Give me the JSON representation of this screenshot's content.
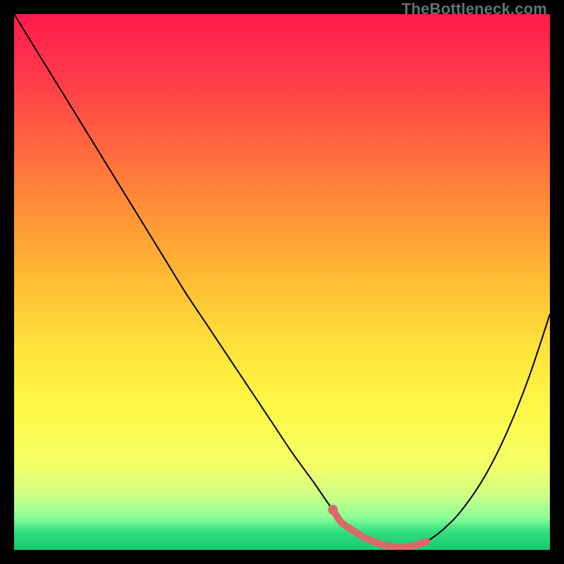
{
  "watermark": "TheBottleneck.com",
  "chart_data": {
    "type": "line",
    "title": "",
    "xlabel": "",
    "ylabel": "",
    "xlim": [
      0,
      100
    ],
    "ylim": [
      0,
      100
    ],
    "gradient_stops": [
      {
        "pos": 0.0,
        "color": "#ff1a4b"
      },
      {
        "pos": 0.12,
        "color": "#ff3a4b"
      },
      {
        "pos": 0.3,
        "color": "#ff7a3a"
      },
      {
        "pos": 0.48,
        "color": "#ffb733"
      },
      {
        "pos": 0.62,
        "color": "#ffe23a"
      },
      {
        "pos": 0.74,
        "color": "#fff948"
      },
      {
        "pos": 0.84,
        "color": "#f4ff66"
      },
      {
        "pos": 0.9,
        "color": "#ccff88"
      },
      {
        "pos": 0.94,
        "color": "#8bff99"
      },
      {
        "pos": 0.965,
        "color": "#33e07f"
      },
      {
        "pos": 1.0,
        "color": "#18c86a"
      }
    ],
    "series": [
      {
        "name": "bottleneck-curve",
        "color": "#000000",
        "width": 2,
        "x": [
          0.0,
          4.0,
          8.0,
          12.0,
          16.0,
          20.0,
          24.0,
          28.0,
          32.0,
          36.0,
          40.0,
          44.0,
          48.0,
          52.0,
          56.0,
          59.5,
          63.0,
          67.0,
          71.0,
          74.0,
          77.0,
          80.5,
          84.0,
          88.0,
          92.0,
          96.0,
          100.0
        ],
        "values": [
          100.0,
          93.5,
          87.0,
          80.5,
          74.0,
          67.5,
          61.0,
          54.5,
          48.0,
          42.0,
          36.0,
          30.0,
          24.0,
          18.0,
          12.5,
          7.5,
          3.8,
          1.6,
          0.6,
          0.6,
          1.6,
          4.2,
          8.0,
          14.0,
          22.0,
          32.0,
          44.0
        ]
      },
      {
        "name": "optimal-marker",
        "color": "#d86a6a",
        "width": 10,
        "cap": "round",
        "x": [
          59.5,
          61.0,
          63.0,
          65.0,
          67.0,
          69.0,
          71.0,
          73.0,
          75.0,
          77.0
        ],
        "values": [
          7.5,
          5.2,
          3.8,
          2.5,
          1.6,
          0.9,
          0.6,
          0.5,
          0.9,
          1.6
        ]
      }
    ],
    "points": [
      {
        "name": "marker-start-dot",
        "x": 59.5,
        "y": 7.5,
        "r": 7,
        "color": "#d86a6a"
      }
    ]
  }
}
